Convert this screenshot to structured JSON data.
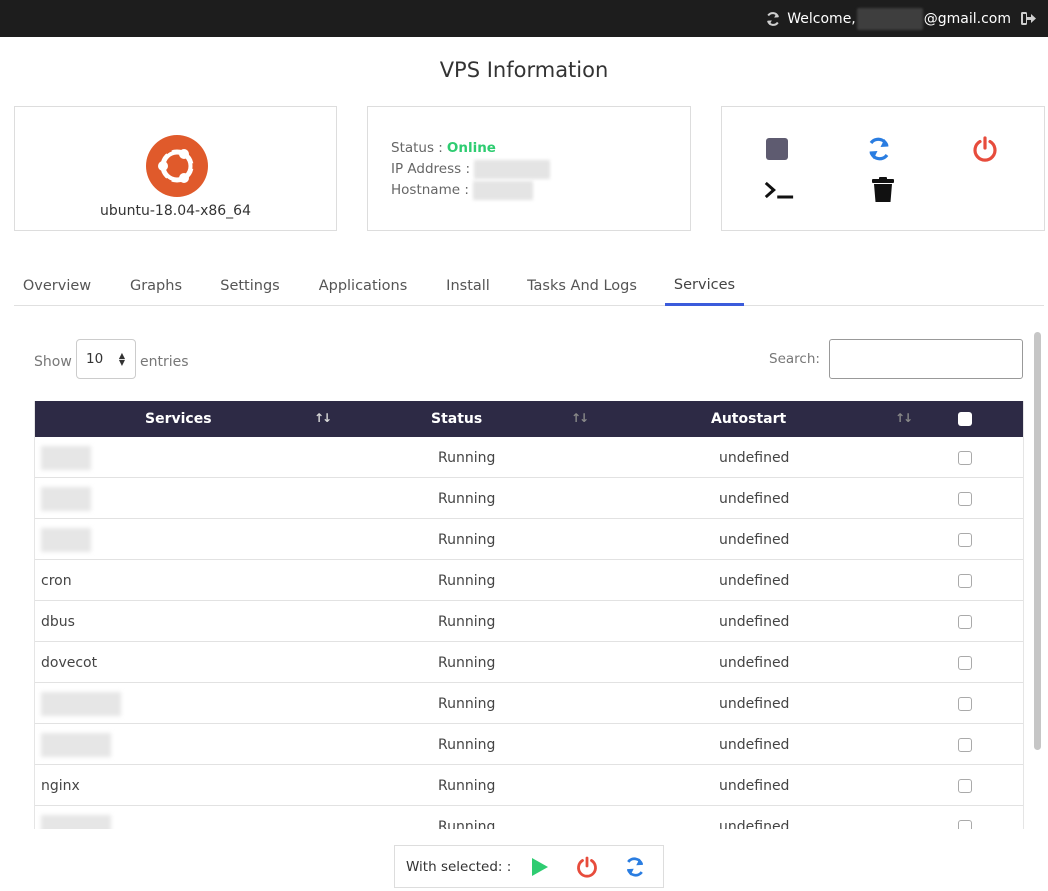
{
  "topbar": {
    "welcome_prefix": "Welcome,",
    "email_suffix": "@gmail.com",
    "refresh_icon": "refresh-icon",
    "logout_icon": "logout-icon"
  },
  "page": {
    "title": "VPS Information"
  },
  "os": {
    "name": "ubuntu-18.04-x86_64",
    "logo_color": "#e05a2b"
  },
  "info": {
    "status_label": "Status :",
    "status_value": "Online",
    "status_color": "#2ecc71",
    "ip_label": "IP Address :",
    "hostname_label": "Hostname :"
  },
  "actions": {
    "stop_icon": "stop-icon",
    "restart_icon": "restart-icon",
    "power_icon": "power-icon",
    "console_icon": "console-icon",
    "delete_icon": "trash-icon",
    "colors": {
      "stop": "#5e5b70",
      "restart": "#2a7de1",
      "power": "#e74c3c",
      "dark": "#111111"
    }
  },
  "tabs": [
    {
      "label": "Overview",
      "active": false
    },
    {
      "label": "Graphs",
      "active": false
    },
    {
      "label": "Settings",
      "active": false
    },
    {
      "label": "Applications",
      "active": false
    },
    {
      "label": "Install",
      "active": false
    },
    {
      "label": "Tasks And Logs",
      "active": false
    },
    {
      "label": "Services",
      "active": true
    }
  ],
  "table_controls": {
    "show_label": "Show",
    "page_length": "10",
    "entries_label": "entries",
    "search_label": "Search:",
    "search_value": ""
  },
  "table": {
    "headers": {
      "services": "Services",
      "status": "Status",
      "autostart": "Autostart"
    },
    "header_bg": "#2d2a45",
    "rows": [
      {
        "name": "",
        "status": "Running",
        "autostart": "undefined"
      },
      {
        "name": "",
        "status": "Running",
        "autostart": "undefined"
      },
      {
        "name": "",
        "status": "Running",
        "autostart": "undefined"
      },
      {
        "name": "cron",
        "status": "Running",
        "autostart": "undefined"
      },
      {
        "name": "dbus",
        "status": "Running",
        "autostart": "undefined"
      },
      {
        "name": "dovecot",
        "status": "Running",
        "autostart": "undefined"
      },
      {
        "name": "",
        "status": "Running",
        "autostart": "undefined"
      },
      {
        "name": "",
        "status": "Running",
        "autostart": "undefined"
      },
      {
        "name": "nginx",
        "status": "Running",
        "autostart": "undefined"
      },
      {
        "name": "",
        "status": "Running",
        "autostart": "undefined"
      }
    ]
  },
  "bulk": {
    "label": "With selected: :",
    "start_icon": "play-icon",
    "stop_icon": "power-icon",
    "restart_icon": "restart-icon",
    "colors": {
      "start": "#2ecc71",
      "stop": "#e74c3c",
      "restart": "#2a7de1"
    }
  }
}
